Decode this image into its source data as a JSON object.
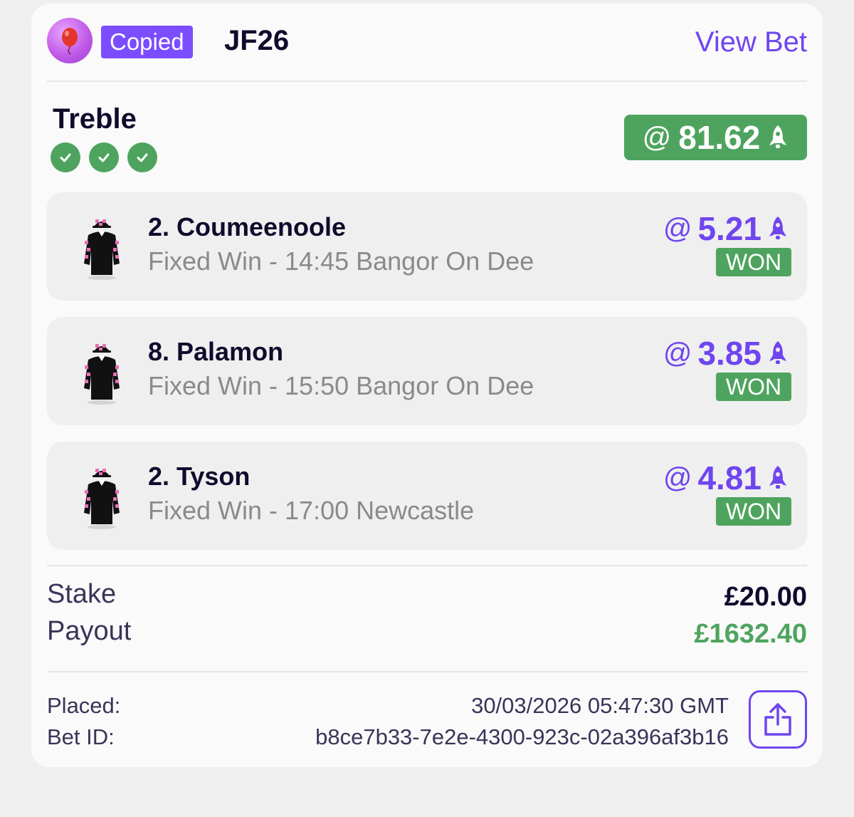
{
  "header": {
    "badge_label": "Copied",
    "username": "JF26",
    "view_bet_label": "View Bet"
  },
  "bet": {
    "type": "Treble",
    "total_odds_prefix": "@",
    "total_odds": "81.62",
    "legs": [
      {
        "name": "2. Coumeenoole",
        "description": "Fixed Win - 14:45 Bangor On Dee",
        "odds_prefix": "@",
        "odds": "5.21",
        "result": "WON"
      },
      {
        "name": "8. Palamon",
        "description": "Fixed Win - 15:50 Bangor On Dee",
        "odds_prefix": "@",
        "odds": "3.85",
        "result": "WON"
      },
      {
        "name": "2. Tyson",
        "description": "Fixed Win - 17:00 Newcastle",
        "odds_prefix": "@",
        "odds": "4.81",
        "result": "WON"
      }
    ]
  },
  "summary": {
    "stake_label": "Stake",
    "stake_value": "£20.00",
    "payout_label": "Payout",
    "payout_value": "£1632.40"
  },
  "meta": {
    "placed_label": "Placed:",
    "placed_value": "30/03/2026 05:47:30 GMT",
    "bet_id_label": "Bet ID:",
    "bet_id_value": "b8ce7b33-7e2e-4300-923c-02a396af3b16"
  },
  "colors": {
    "accent": "#6f45ef",
    "success": "#4ea45e",
    "badge": "#7b4dff"
  },
  "icons": [
    "balloon-icon",
    "check-icon",
    "rocket-icon",
    "jockey-silk-icon",
    "share-icon"
  ]
}
